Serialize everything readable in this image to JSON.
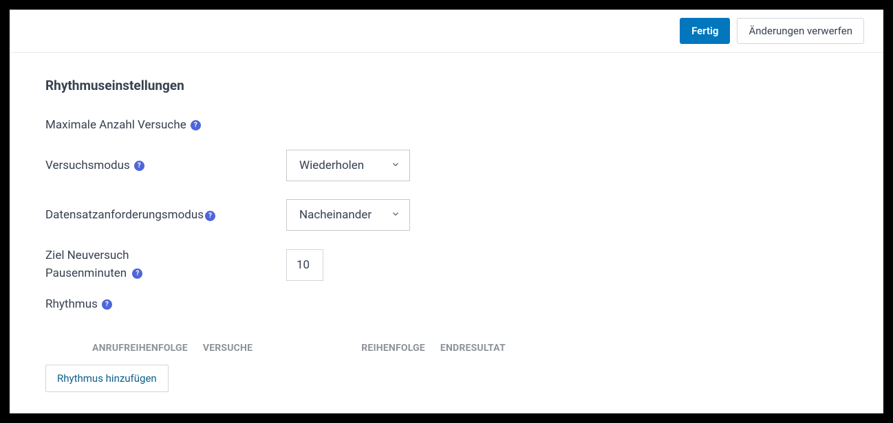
{
  "actions": {
    "done": "Fertig",
    "discard": "Änderungen verwerfen"
  },
  "section": {
    "title": "Rhythmuseinstellungen"
  },
  "fields": {
    "maxAttempts": {
      "label": "Maximale Anzahl Versuche"
    },
    "attemptMode": {
      "label": "Versuchsmodus",
      "value": "Wiederholen"
    },
    "recordRequestMode": {
      "label": "Datensatzanforderungsmodus",
      "value": "Nacheinander"
    },
    "retryPause": {
      "line1": "Ziel Neuversuch",
      "line2": "Pausenminuten",
      "value": "10"
    },
    "cadence": {
      "label": "Rhythmus"
    }
  },
  "table": {
    "headers": {
      "callOrder": "ANRUFREIHENFOLGE",
      "attempts": "VERSUCHE",
      "order": "REIHENFOLGE",
      "endResult": "ENDRESULTAT"
    }
  },
  "buttons": {
    "addCadence": "Rhythmus hinzufügen"
  }
}
